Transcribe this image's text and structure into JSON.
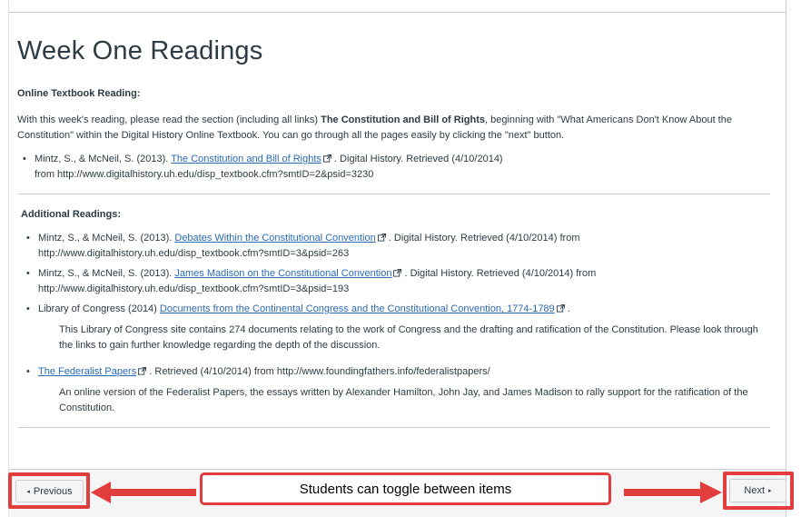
{
  "page": {
    "title": "Week One Readings"
  },
  "textbook": {
    "heading": "Online Textbook Reading:",
    "intro_pre": "With this week's reading, please read the section (including all links) ",
    "intro_bold": "The Constitution and Bill of Rights",
    "intro_post": ", beginning with \"What Americans Don't Know About the Constitution\" within the Digital History Online Textbook. You can go through all the pages easily by clicking the \"next\" button.",
    "citation": {
      "pre": "Mintz, S., & McNeil, S. (2013). ",
      "link": "The Constitution and Bill of Rights",
      "post": " . Digital History. Retrieved (4/10/2014)",
      "line2": "from http://www.digitalhistory.uh.edu/disp_textbook.cfm?smtID=2&psid=3230"
    }
  },
  "additional": {
    "heading": "Additional Readings:",
    "items": [
      {
        "pre": "Mintz, S., & McNeil, S. (2013). ",
        "link": "Debates Within the Constitutional Convention",
        "post": " . Digital History. Retrieved (4/10/2014) from",
        "line2": "http://www.digitalhistory.uh.edu/disp_textbook.cfm?smtID=3&psid=263"
      },
      {
        "pre": "Mintz, S., & McNeil, S. (2013). ",
        "link": "James Madison on the Constitutional Convention",
        "post": " . Digital History. Retrieved (4/10/2014) from",
        "line2": "http://www.digitalhistory.uh.edu/disp_textbook.cfm?smtID=3&psid=193"
      },
      {
        "pre": "Library of Congress (2014) ",
        "link": "Documents from the Continental Congress and the Constitutional Convention, 1774-1789",
        "post": " .",
        "description": "This Library of Congress site contains 274 documents relating to the work of Congress and the drafting and ratification of the Constitution. Please look through the links to gain further knowledge regarding the depth of the discussion."
      },
      {
        "pre": "",
        "link": "The Federalist Papers",
        "post": " . Retrieved (4/10/2014) from http://www.foundingfathers.info/federalistpapers/",
        "description": "An online version of the Federalist Papers, the essays written by Alexander Hamilton, John Jay, and James Madison to rally support for the ratification of the Constitution."
      }
    ]
  },
  "footer": {
    "previous_label": "Previous",
    "next_label": "Next",
    "prev_glyph": "◂",
    "next_glyph": "▸"
  },
  "annotation": {
    "callout_text": "Students can toggle between items",
    "color": "#e23d3d"
  },
  "icons": {
    "external_link": "external-link-icon"
  },
  "colors": {
    "link": "#2a6bb7",
    "text": "#2d3b45",
    "border": "#c7cdd1"
  }
}
